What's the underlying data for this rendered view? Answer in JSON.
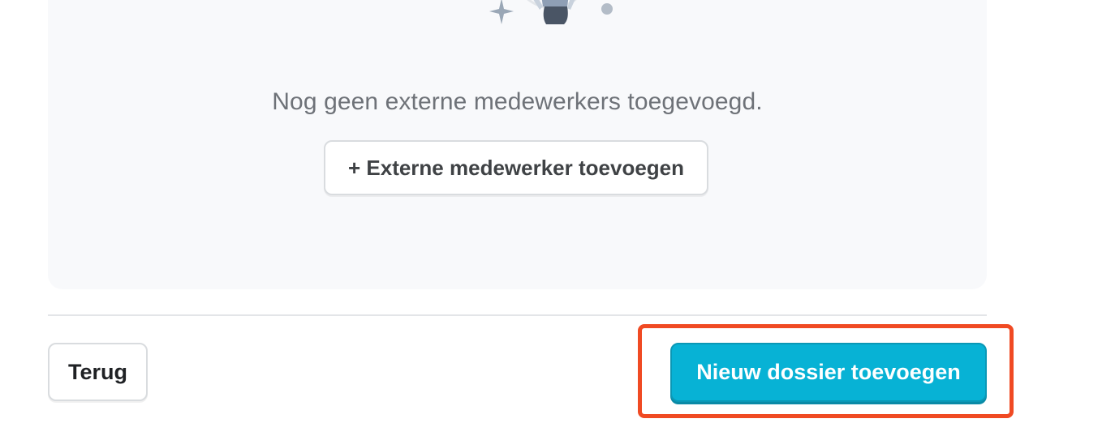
{
  "empty_state": {
    "illustration_icon": "person-avatar-icon",
    "message": "Nog geen externe medewerkers toegevoegd.",
    "add_button_label": "+ Externe medewerker toevoegen"
  },
  "footer": {
    "back_label": "Terug",
    "primary_label": "Nieuw dossier toevoegen",
    "highlight_color": "#f04a23",
    "primary_color": "#07b2d5"
  }
}
